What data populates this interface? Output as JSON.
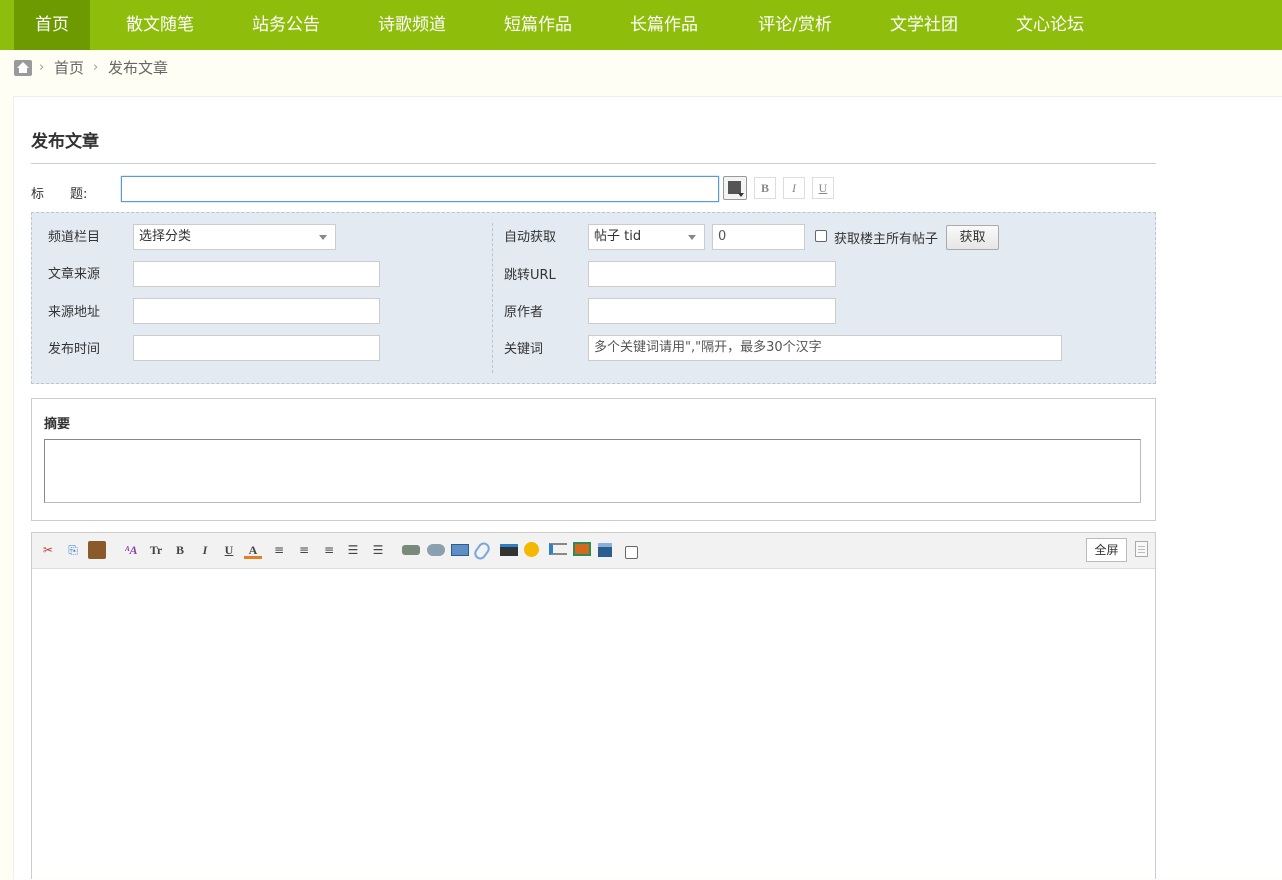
{
  "nav": {
    "items": [
      {
        "label": "首页",
        "active": true
      },
      {
        "label": "散文随笔"
      },
      {
        "label": "站务公告"
      },
      {
        "label": "诗歌频道"
      },
      {
        "label": "短篇作品"
      },
      {
        "label": "长篇作品"
      },
      {
        "label": "评论/赏析"
      },
      {
        "label": "文学社团"
      },
      {
        "label": "文心论坛"
      }
    ]
  },
  "breadcrumb": {
    "home": "首页",
    "current": "发布文章",
    "home_icon": "home-icon"
  },
  "page": {
    "title": "发布文章"
  },
  "title_row": {
    "label": "标　　题:",
    "value": "",
    "bold": "B",
    "italic": "I",
    "underline": "U"
  },
  "meta": {
    "channel_label": "频道栏目",
    "channel_value": "选择分类",
    "source_label": "文章来源",
    "source_value": "",
    "source_url_label": "来源地址",
    "source_url_value": "",
    "publish_time_label": "发布时间",
    "publish_time_value": "",
    "auto_fetch_label": "自动获取",
    "auto_fetch_type": "帖子 tid",
    "auto_fetch_value": "0",
    "fetch_all_label": "获取楼主所有帖子",
    "fetch_button": "获取",
    "redirect_label": "跳转URL",
    "redirect_value": "",
    "author_label": "原作者",
    "author_value": "",
    "keywords_label": "关键词",
    "keywords_value": "多个关键词请用\",\"隔开，最多30个汉字"
  },
  "summary": {
    "label": "摘要",
    "value": ""
  },
  "editor": {
    "fullscreen_label": "全屏",
    "toolbar": {
      "cut": "✂",
      "copy": "⎘",
      "paste": "📋",
      "font": "ᴬA",
      "size": "Tr",
      "bold": "B",
      "italic": "I",
      "underline": "U",
      "color": "A",
      "align_left": "≡",
      "align_center": "≡",
      "align_right": "≡",
      "ordered_list": "☰",
      "indent": "☰"
    },
    "colors": {
      "accent": "#8fbd0c",
      "active_nav": "#6c9a00"
    }
  }
}
